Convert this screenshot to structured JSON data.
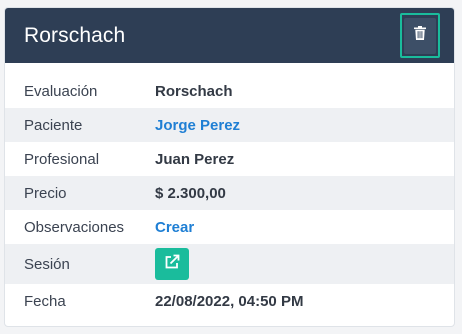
{
  "card": {
    "title": "Rorschach"
  },
  "rows": [
    {
      "label": "Evaluación",
      "value": "Rorschach"
    },
    {
      "label": "Paciente",
      "value": "Jorge Perez"
    },
    {
      "label": "Profesional",
      "value": "Juan Perez"
    },
    {
      "label": "Precio",
      "value": "$ 2.300,00"
    },
    {
      "label": "Observaciones",
      "value": "Crear"
    },
    {
      "label": "Sesión",
      "value": ""
    },
    {
      "label": "Fecha",
      "value": "22/08/2022, 04:50 PM"
    }
  ],
  "icons": {
    "delete": "trash-icon",
    "edit": "external-edit-icon"
  },
  "colors": {
    "header": "#2e3e55",
    "accent": "#1abc9c",
    "link": "#1f7fd4",
    "stripe": "#eef0f3"
  }
}
